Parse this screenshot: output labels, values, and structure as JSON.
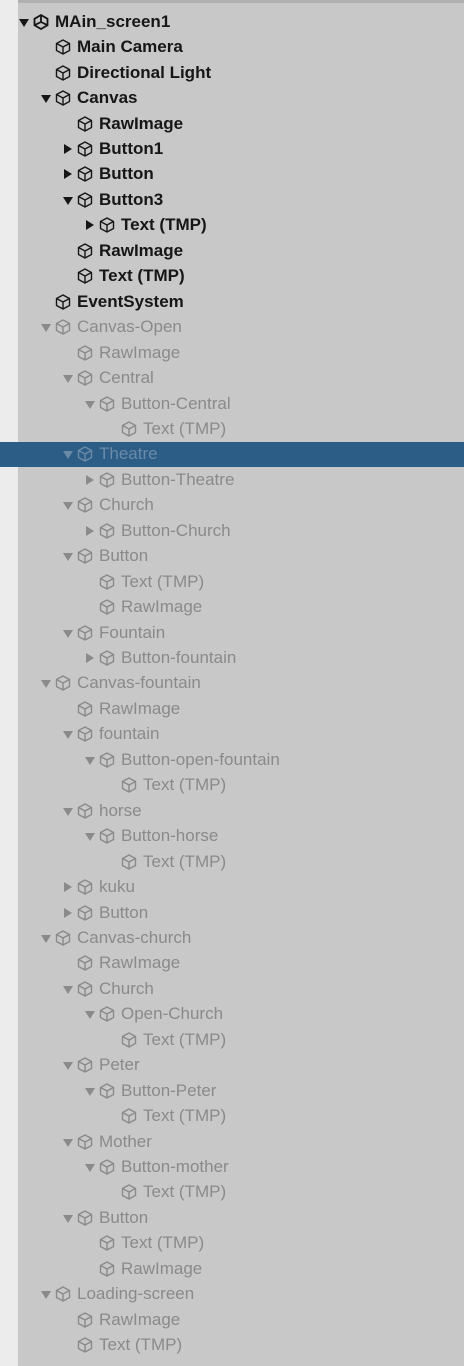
{
  "hierarchy": {
    "colors": {
      "panel": "#c8c8c8",
      "selection": "#2c5d87",
      "active_text": "#161616",
      "inactive_text": "#8a8a8a"
    },
    "scene": {
      "label": "MAin_screen1",
      "icon": "unity-logo-icon"
    },
    "items": [
      {
        "label": "Main Camera",
        "level": 1,
        "arrow": "none",
        "active": true
      },
      {
        "label": "Directional Light",
        "level": 1,
        "arrow": "none",
        "active": true
      },
      {
        "label": "Canvas",
        "level": 1,
        "arrow": "down",
        "active": true
      },
      {
        "label": "RawImage",
        "level": 2,
        "arrow": "none",
        "active": true
      },
      {
        "label": "Button1",
        "level": 2,
        "arrow": "right",
        "active": true
      },
      {
        "label": "Button",
        "level": 2,
        "arrow": "right",
        "active": true
      },
      {
        "label": "Button3",
        "level": 2,
        "arrow": "down",
        "active": true
      },
      {
        "label": "Text (TMP)",
        "level": 3,
        "arrow": "right",
        "active": true
      },
      {
        "label": "RawImage",
        "level": 2,
        "arrow": "none",
        "active": true
      },
      {
        "label": "Text (TMP)",
        "level": 2,
        "arrow": "none",
        "active": true
      },
      {
        "label": "EventSystem",
        "level": 1,
        "arrow": "none",
        "active": true
      },
      {
        "label": "Canvas-Open",
        "level": 1,
        "arrow": "down",
        "active": false
      },
      {
        "label": "RawImage",
        "level": 2,
        "arrow": "none",
        "active": false
      },
      {
        "label": "Central",
        "level": 2,
        "arrow": "down",
        "active": false
      },
      {
        "label": "Button-Central",
        "level": 3,
        "arrow": "down",
        "active": false
      },
      {
        "label": "Text (TMP)",
        "level": 4,
        "arrow": "none",
        "active": false
      },
      {
        "label": "Theatre",
        "level": 2,
        "arrow": "down",
        "active": false,
        "selected": true
      },
      {
        "label": "Button-Theatre",
        "level": 3,
        "arrow": "right",
        "active": false
      },
      {
        "label": "Church",
        "level": 2,
        "arrow": "down",
        "active": false
      },
      {
        "label": "Button-Church",
        "level": 3,
        "arrow": "right",
        "active": false
      },
      {
        "label": "Button",
        "level": 2,
        "arrow": "down",
        "active": false
      },
      {
        "label": "Text (TMP)",
        "level": 3,
        "arrow": "none",
        "active": false
      },
      {
        "label": "RawImage",
        "level": 3,
        "arrow": "none",
        "active": false
      },
      {
        "label": "Fountain",
        "level": 2,
        "arrow": "down",
        "active": false
      },
      {
        "label": "Button-fountain",
        "level": 3,
        "arrow": "right",
        "active": false
      },
      {
        "label": "Canvas-fountain",
        "level": 1,
        "arrow": "down",
        "active": false
      },
      {
        "label": "RawImage",
        "level": 2,
        "arrow": "none",
        "active": false
      },
      {
        "label": "fountain",
        "level": 2,
        "arrow": "down",
        "active": false
      },
      {
        "label": "Button-open-fountain",
        "level": 3,
        "arrow": "down",
        "active": false
      },
      {
        "label": "Text (TMP)",
        "level": 4,
        "arrow": "none",
        "active": false
      },
      {
        "label": "horse",
        "level": 2,
        "arrow": "down",
        "active": false
      },
      {
        "label": "Button-horse",
        "level": 3,
        "arrow": "down",
        "active": false
      },
      {
        "label": "Text (TMP)",
        "level": 4,
        "arrow": "none",
        "active": false
      },
      {
        "label": "kuku",
        "level": 2,
        "arrow": "right",
        "active": false
      },
      {
        "label": "Button",
        "level": 2,
        "arrow": "right",
        "active": false
      },
      {
        "label": "Canvas-church",
        "level": 1,
        "arrow": "down",
        "active": false
      },
      {
        "label": "RawImage",
        "level": 2,
        "arrow": "none",
        "active": false
      },
      {
        "label": "Church",
        "level": 2,
        "arrow": "down",
        "active": false
      },
      {
        "label": "Open-Church",
        "level": 3,
        "arrow": "down",
        "active": false
      },
      {
        "label": "Text (TMP)",
        "level": 4,
        "arrow": "none",
        "active": false
      },
      {
        "label": "Peter",
        "level": 2,
        "arrow": "down",
        "active": false
      },
      {
        "label": "Button-Peter",
        "level": 3,
        "arrow": "down",
        "active": false
      },
      {
        "label": "Text (TMP)",
        "level": 4,
        "arrow": "none",
        "active": false
      },
      {
        "label": "Mother",
        "level": 2,
        "arrow": "down",
        "active": false
      },
      {
        "label": "Button-mother",
        "level": 3,
        "arrow": "down",
        "active": false
      },
      {
        "label": "Text (TMP)",
        "level": 4,
        "arrow": "none",
        "active": false
      },
      {
        "label": "Button",
        "level": 2,
        "arrow": "down",
        "active": false
      },
      {
        "label": "Text (TMP)",
        "level": 3,
        "arrow": "none",
        "active": false
      },
      {
        "label": "RawImage",
        "level": 3,
        "arrow": "none",
        "active": false
      },
      {
        "label": "Loading-screen",
        "level": 1,
        "arrow": "down",
        "active": false
      },
      {
        "label": "RawImage",
        "level": 2,
        "arrow": "none",
        "active": false
      },
      {
        "label": "Text (TMP)",
        "level": 2,
        "arrow": "none",
        "active": false
      }
    ]
  }
}
